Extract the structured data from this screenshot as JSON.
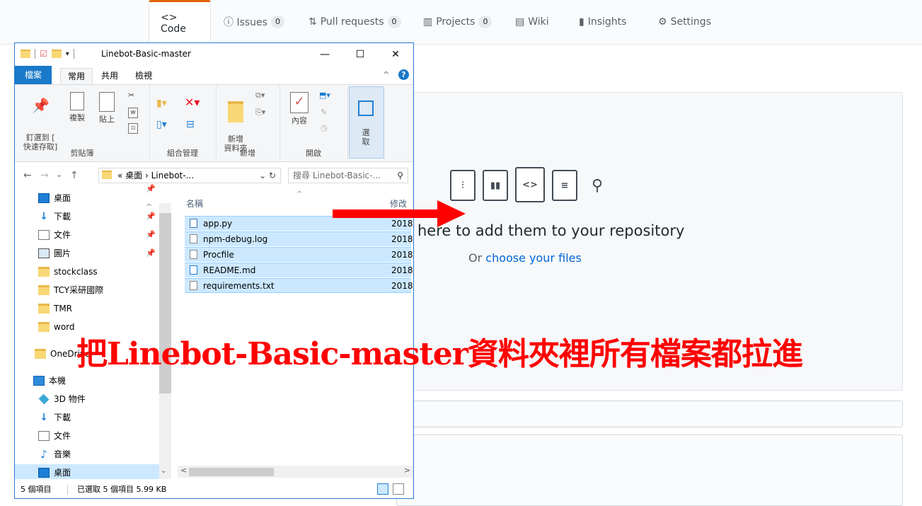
{
  "github": {
    "tabs": [
      {
        "label": "<> Code",
        "count": null
      },
      {
        "label": "ⓘ Issues",
        "count": "0"
      },
      {
        "label": "Pull requests",
        "count": "0"
      },
      {
        "label": "Projects",
        "count": "0"
      },
      {
        "label": "Wiki",
        "count": null
      },
      {
        "label": "Insights",
        "count": null
      },
      {
        "label": "Settings",
        "count": null
      }
    ],
    "drop_title": "here to add them to your repository",
    "drop_sub_prefix": "Or ",
    "drop_sub_link": "choose your files"
  },
  "explorer": {
    "title": "Linebot-Basic-master",
    "window_buttons": {
      "minimize": "—",
      "maximize": "☐",
      "close": "✕"
    },
    "ribbon_tabs": [
      "檔案",
      "常用",
      "共用",
      "檢視"
    ],
    "ribbon": {
      "clipboard": {
        "pin": "釘選到 [\n快速存取]",
        "copy": "複製",
        "paste": "貼上",
        "label": "剪貼簿"
      },
      "organize": {
        "label": "組合管理"
      },
      "new": {
        "new_folder": "新增\n資料夾",
        "label": "新增"
      },
      "open": {
        "properties": "內容",
        "label": "開啟"
      },
      "select": {
        "select": "選\n取"
      }
    },
    "address": "« 桌面 › Linebot-...",
    "search_placeholder": "搜尋 Linebot-Basic-...",
    "nav_items": [
      {
        "label": "桌面",
        "icon": "desktop-icon",
        "pinned": true
      },
      {
        "label": "下載",
        "icon": "download-icon",
        "pinned": true
      },
      {
        "label": "文件",
        "icon": "document-icon",
        "pinned": true
      },
      {
        "label": "圖片",
        "icon": "picture-icon",
        "pinned": true
      },
      {
        "label": "stockclass",
        "icon": "folder-icon",
        "pinned": false
      },
      {
        "label": "TCY采研國際",
        "icon": "folder-icon",
        "pinned": false
      },
      {
        "label": "TMR",
        "icon": "folder-icon",
        "pinned": false
      },
      {
        "label": "word",
        "icon": "folder-icon",
        "pinned": false
      },
      {
        "label": "OneDrive",
        "icon": "folder-icon",
        "pinned": false
      },
      {
        "label": "本機",
        "icon": "pc-icon",
        "pinned": false
      },
      {
        "label": "3D 物件",
        "icon": "3d-icon",
        "pinned": false
      },
      {
        "label": "下載",
        "icon": "download-icon",
        "pinned": false
      },
      {
        "label": "文件",
        "icon": "document-icon",
        "pinned": false
      },
      {
        "label": "音樂",
        "icon": "music-icon",
        "pinned": false
      },
      {
        "label": "桌面",
        "icon": "desktop-icon",
        "pinned": false
      }
    ],
    "columns": {
      "name": "名稱",
      "modified": "修改日"
    },
    "files": [
      {
        "name": "app.py",
        "date": "2018/"
      },
      {
        "name": "npm-debug.log",
        "date": "2018/"
      },
      {
        "name": "Procfile",
        "date": "2018/"
      },
      {
        "name": "README.md",
        "date": "2018/"
      },
      {
        "name": "requirements.txt",
        "date": "2018/"
      }
    ],
    "status": {
      "count": "5 個項目",
      "selected": "已選取 5 個項目  5.99 KB"
    }
  },
  "overlay": {
    "caption": "把Linebot-Basic-master資料夾裡所有檔案都拉進",
    "arrow_color": "#ff0000"
  },
  "colors": {
    "accent": "#1979ca",
    "selection": "#cce8ff",
    "link": "#0366d6",
    "caption": "#ff0000"
  }
}
